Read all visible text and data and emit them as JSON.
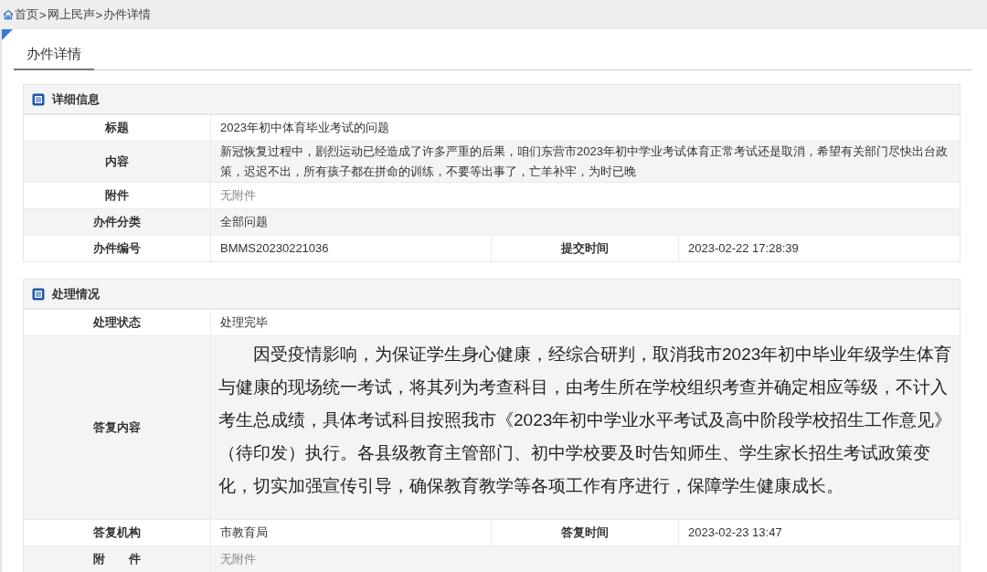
{
  "breadcrumb": [
    {
      "label": "首页"
    },
    {
      "label": ">"
    },
    {
      "label": "网上民声"
    },
    {
      "label": ">"
    },
    {
      "label": "办件详情"
    }
  ],
  "page_tab": {
    "label": "办件详情",
    "selected": true
  },
  "sections": [
    {
      "title": "详细信息",
      "rows": [
        {
          "kind": "single",
          "label": "标题",
          "value": "2023年初中体育毕业考试的问题",
          "muted": false
        },
        {
          "kind": "single",
          "label": "内容",
          "value": "新冠恢复过程中，剧烈运动已经造成了许多严重的后果，咱们东营市2023年初中学业考试体育正常考试还是取消，希望有关部门尽快出台政策，迟迟不出，所有孩子都在拼命的训练，不要等出事了，亡羊补牢，为时已晚",
          "muted": false
        },
        {
          "kind": "single",
          "label": "附件",
          "value": "无附件",
          "muted": true
        },
        {
          "kind": "single",
          "label": "办件分类",
          "value": "全部问题",
          "muted": false
        },
        {
          "kind": "pair",
          "label": "办件编号",
          "value": "BMMS20230221036",
          "label_2": "提交时间",
          "value_2": "2023-02-22 17:28:39"
        }
      ]
    },
    {
      "title": "处理情况",
      "rows": [
        {
          "kind": "single",
          "label": "处理状态",
          "value": "处理完毕",
          "muted": false
        },
        {
          "kind": "article",
          "label": "答复内容",
          "value": "因受疫情影响，为保证学生身心健康，经综合研判，取消我市2023年初中毕业年级学生体育与健康的现场统一考试，将其列为考查科目，由考生所在学校组织考查并确定相应等级，不计入考生总成绩，具体考试科目按照我市《2023年初中学业水平考试及高中阶段学校招生工作意见》（待印发）执行。各县级教育主管部门、初中学校要及时告知师生、学生家长招生考试政策变化，切实加强宣传引导，确保教育教学等各项工作有序进行，保障学生健康成长。"
        },
        {
          "kind": "pair",
          "label": "答复机构",
          "value": "市教育局",
          "label_2": "答复时间",
          "value_2": "2023-02-23 13:47"
        },
        {
          "kind": "single",
          "label": "附　　件",
          "value": "无附件",
          "muted": true
        }
      ]
    }
  ]
}
